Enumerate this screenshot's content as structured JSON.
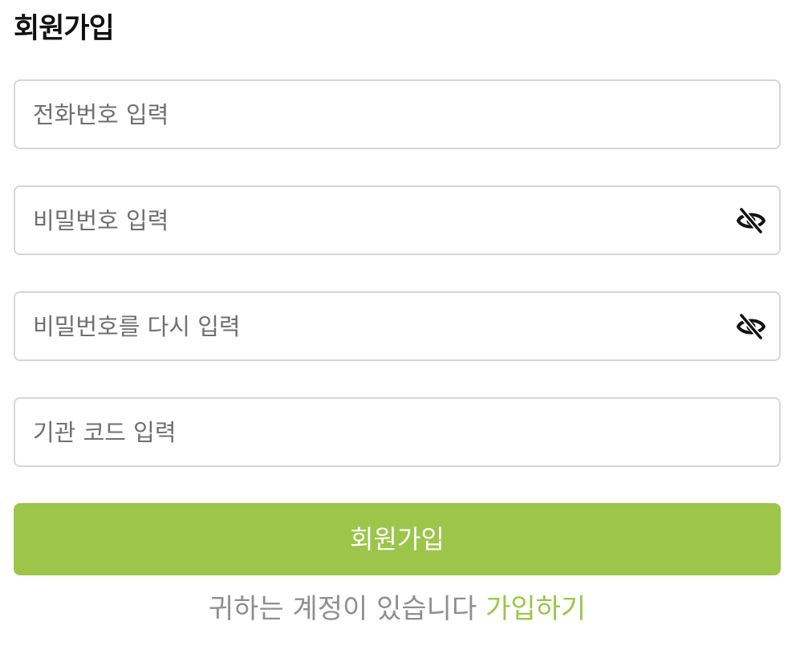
{
  "page": {
    "title": "회원가입"
  },
  "form": {
    "phone": {
      "placeholder": "전화번호 입력",
      "value": ""
    },
    "password": {
      "placeholder": "비밀번호 입력",
      "value": "",
      "toggle_icon": "eye-off-icon"
    },
    "password_confirm": {
      "placeholder": "비밀번호를 다시 입력",
      "value": "",
      "toggle_icon": "eye-off-icon"
    },
    "org_code": {
      "placeholder": "기관 코드 입력",
      "value": ""
    },
    "submit_label": "회원가입"
  },
  "footer": {
    "text": "귀하는 계정이 있습니다",
    "link_label": "가입하기"
  },
  "colors": {
    "accent": "#9cc54a",
    "border": "#d6d6d6",
    "placeholder": "#6f6f6f",
    "footer_text": "#8f8f8f"
  }
}
